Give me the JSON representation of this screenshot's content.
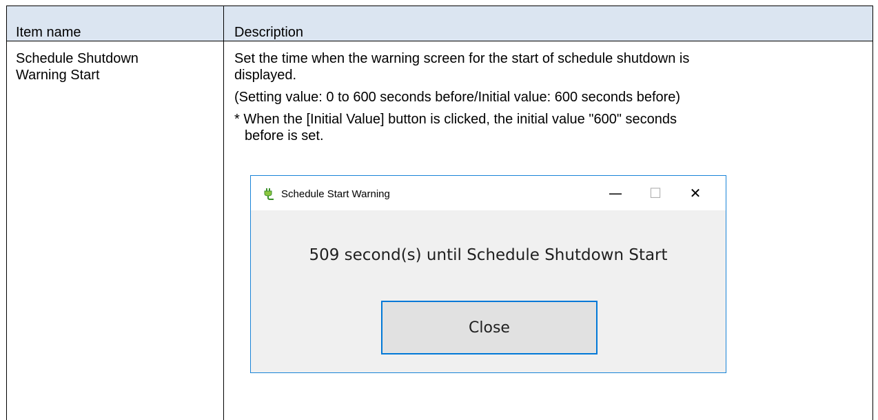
{
  "table": {
    "headers": [
      "Item name",
      "Description"
    ],
    "row": {
      "item_name_line1": "Schedule Shutdown",
      "item_name_line2": "Warning Start",
      "description_lines": [
        "Set the time when the warning screen for the start of schedule shutdown is",
        "displayed.",
        "(Setting value: 0 to 600 seconds before/Initial value: 600 seconds before)",
        "* When the [Initial Value] button is clicked, the initial value \"600\" seconds",
        "before is set."
      ]
    }
  },
  "dialog": {
    "title": "Schedule Start Warning",
    "minimize_glyph": "—",
    "maximize_glyph": "☐",
    "close_glyph": "✕",
    "message": "509 second(s) until Schedule Shutdown Start",
    "close_button_label": "Close",
    "icon": "plug-icon",
    "accent_color": "#0078d7"
  }
}
